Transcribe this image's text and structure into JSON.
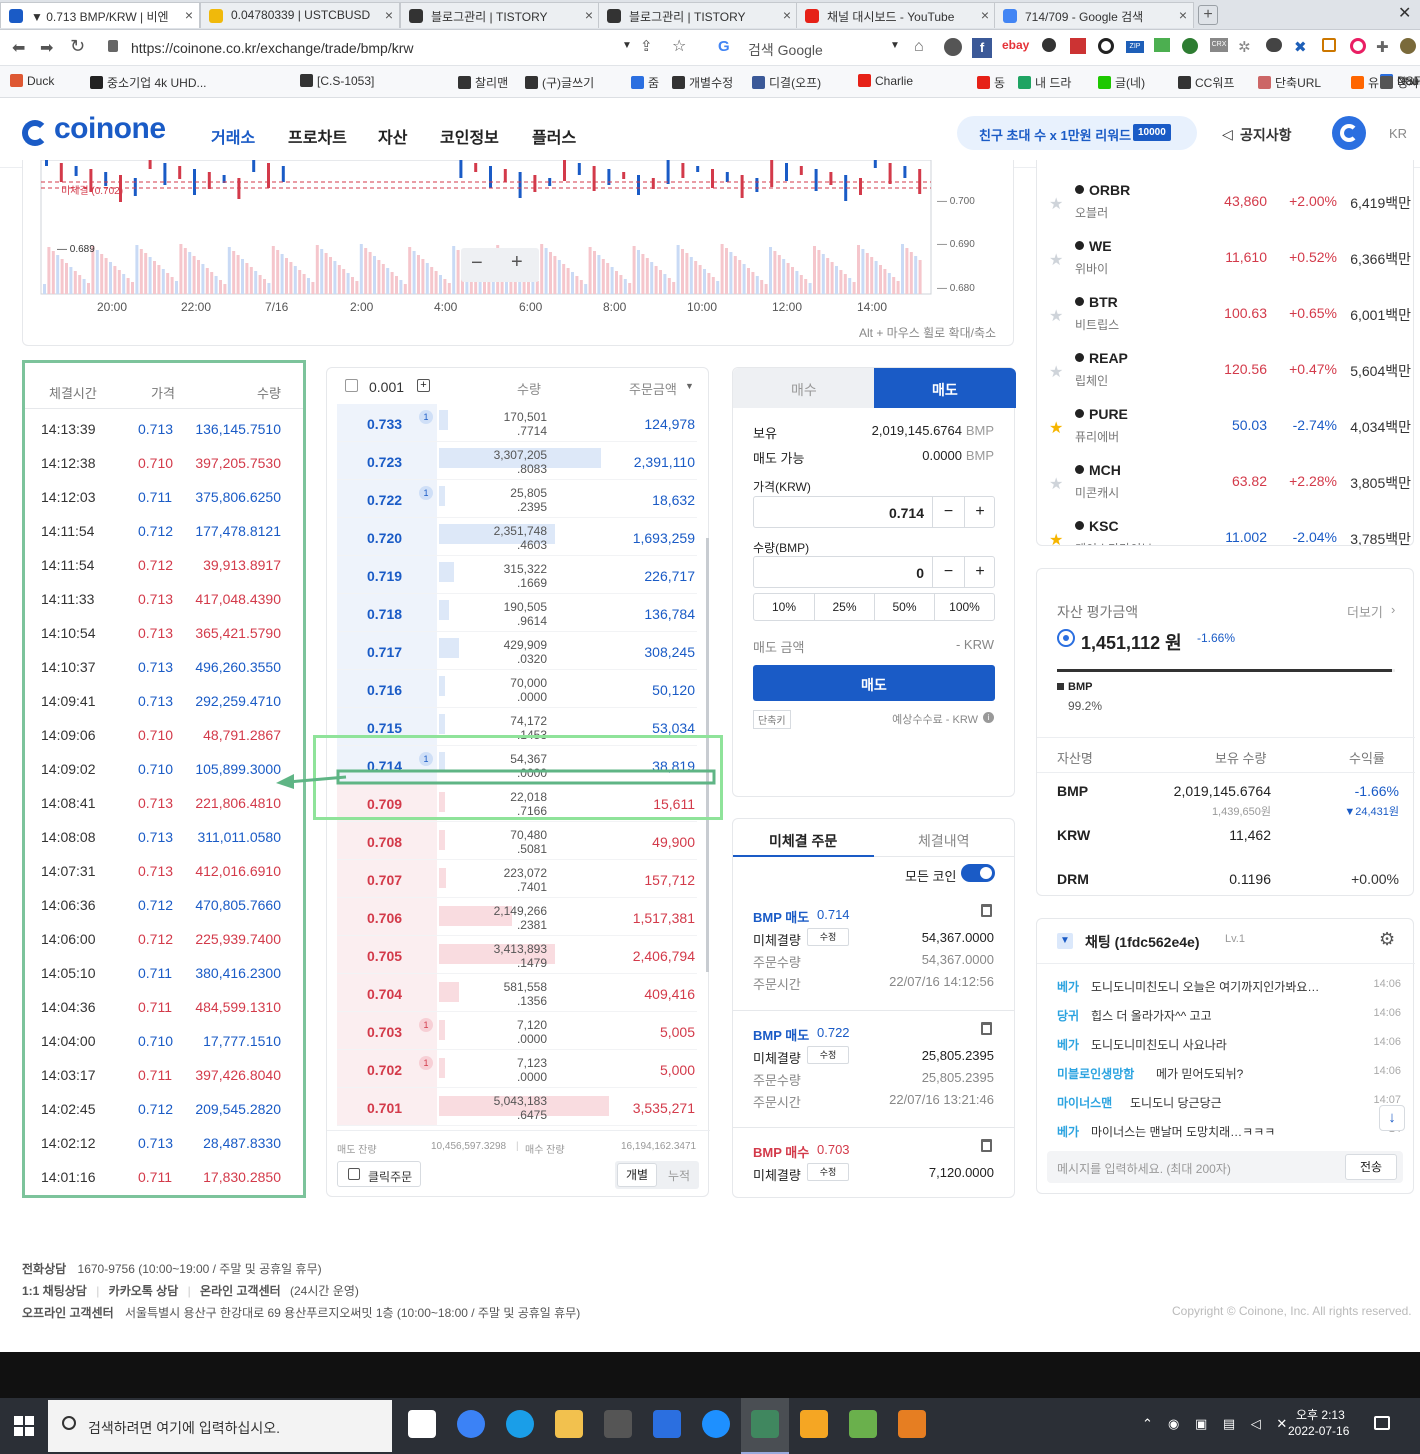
{
  "browser": {
    "tabs": [
      {
        "title": "▼ 0.713 BMP/KRW | 비엔",
        "icon": "coinone-icon",
        "color": "#1a5bc6",
        "active": true
      },
      {
        "title": "0.04780339 | USTCBUSD",
        "icon": "binance-icon",
        "color": "#f0b90b"
      },
      {
        "title": "블로그관리 | TISTORY",
        "icon": "tistory-icon",
        "color": "#333333"
      },
      {
        "title": "블로그관리 | TISTORY",
        "icon": "tistory-icon",
        "color": "#333333"
      },
      {
        "title": "채널 대시보드 - YouTube",
        "icon": "youtube-icon",
        "color": "#e62117"
      },
      {
        "title": "714/709 - Google 검색",
        "icon": "google-icon",
        "color": "#4285f4"
      }
    ],
    "url": "https://coinone.co.kr/exchange/trade/bmp/krw",
    "search_placeholder": "검색 Google",
    "bookmarks": [
      "Duck",
      "중소기업 4k UHD...",
      "[C.S-1053]",
      "찰리맨",
      "(구)글쓰기",
      "줌",
      "개별수정",
      "디결(오프)",
      "Charlie",
      "동",
      "내 드라",
      "글(네)",
      "CC워프",
      "단축URL",
      "유비",
      "NSFW",
      "Daum",
      "영사"
    ]
  },
  "site": {
    "logo": "coinone",
    "nav": [
      "거래소",
      "프로차트",
      "자산",
      "코인정보",
      "플러스"
    ],
    "promo": "친구 초대 수 x 1만원 리워드",
    "promo_badge": "10000",
    "notice": "공지사항",
    "lang": "KR"
  },
  "chart": {
    "x_ticks": [
      "20:00",
      "22:00",
      "7/16",
      "2:00",
      "4:00",
      "6:00",
      "8:00",
      "10:00",
      "12:00",
      "14:00"
    ],
    "y_ticks": [
      "0.700",
      "0.690",
      "0.680"
    ],
    "unfilled_label": "미체결 (0.702)",
    "low_label": "0.689",
    "hint": "Alt + 마우스 휠로 확대/축소",
    "zoom_out": "−",
    "zoom_in": "+"
  },
  "trades": {
    "headers": [
      "체결시간",
      "가격",
      "수량"
    ],
    "rows": [
      {
        "time": "14:13:39",
        "price": "0.713",
        "qty": "136,145.7510",
        "side": "buy"
      },
      {
        "time": "14:12:38",
        "price": "0.710",
        "qty": "397,205.7530",
        "side": "sell"
      },
      {
        "time": "14:12:03",
        "price": "0.711",
        "qty": "375,806.6250",
        "side": "buy"
      },
      {
        "time": "14:11:54",
        "price": "0.712",
        "qty": "177,478.8121",
        "side": "buy"
      },
      {
        "time": "14:11:54",
        "price": "0.712",
        "qty": "39,913.8917",
        "side": "sell"
      },
      {
        "time": "14:11:33",
        "price": "0.713",
        "qty": "417,048.4390",
        "side": "sell"
      },
      {
        "time": "14:10:54",
        "price": "0.713",
        "qty": "365,421.5790",
        "side": "sell"
      },
      {
        "time": "14:10:37",
        "price": "0.713",
        "qty": "496,260.3550",
        "side": "buy"
      },
      {
        "time": "14:09:41",
        "price": "0.713",
        "qty": "292,259.4710",
        "side": "buy"
      },
      {
        "time": "14:09:06",
        "price": "0.710",
        "qty": "48,791.2867",
        "side": "sell"
      },
      {
        "time": "14:09:02",
        "price": "0.710",
        "qty": "105,899.3000",
        "side": "buy"
      },
      {
        "time": "14:08:41",
        "price": "0.713",
        "qty": "221,806.4810",
        "side": "sell"
      },
      {
        "time": "14:08:08",
        "price": "0.713",
        "qty": "311,011.0580",
        "side": "buy"
      },
      {
        "time": "14:07:31",
        "price": "0.713",
        "qty": "412,016.6910",
        "side": "sell"
      },
      {
        "time": "14:06:36",
        "price": "0.712",
        "qty": "470,805.7660",
        "side": "buy"
      },
      {
        "time": "14:06:00",
        "price": "0.712",
        "qty": "225,939.7400",
        "side": "sell"
      },
      {
        "time": "14:05:10",
        "price": "0.711",
        "qty": "380,416.2300",
        "side": "buy"
      },
      {
        "time": "14:04:36",
        "price": "0.711",
        "qty": "484,599.1310",
        "side": "sell"
      },
      {
        "time": "14:04:00",
        "price": "0.710",
        "qty": "17,777.1510",
        "side": "buy"
      },
      {
        "time": "14:03:17",
        "price": "0.711",
        "qty": "397,426.8040",
        "side": "sell"
      },
      {
        "time": "14:02:45",
        "price": "0.712",
        "qty": "209,545.2820",
        "side": "buy"
      },
      {
        "time": "14:02:12",
        "price": "0.713",
        "qty": "28,487.8330",
        "side": "buy"
      },
      {
        "time": "14:01:16",
        "price": "0.711",
        "qty": "17,830.2850",
        "side": "sell"
      }
    ]
  },
  "orderbook": {
    "tick": "0.001",
    "headers": [
      "수량",
      "주문금액"
    ],
    "asks": [
      {
        "price": "0.733",
        "qty1": "170,501",
        "qty2": ".7714",
        "amt": "124,978",
        "badge": "1",
        "depth": 0.05
      },
      {
        "price": "0.723",
        "qty1": "3,307,205",
        "qty2": ".8083",
        "amt": "2,391,110",
        "badge": "",
        "depth": 0.95
      },
      {
        "price": "0.722",
        "qty1": "25,805",
        "qty2": ".2395",
        "amt": "18,632",
        "badge": "1",
        "depth": 0.01
      },
      {
        "price": "0.720",
        "qty1": "2,351,748",
        "qty2": ".4603",
        "amt": "1,693,259",
        "badge": "",
        "depth": 0.68
      },
      {
        "price": "0.719",
        "qty1": "315,322",
        "qty2": ".1669",
        "amt": "226,717",
        "badge": "",
        "depth": 0.09
      },
      {
        "price": "0.718",
        "qty1": "190,505",
        "qty2": ".9614",
        "amt": "136,784",
        "badge": "",
        "depth": 0.06
      },
      {
        "price": "0.717",
        "qty1": "429,909",
        "qty2": ".0320",
        "amt": "308,245",
        "badge": "",
        "depth": 0.12
      },
      {
        "price": "0.716",
        "qty1": "70,000",
        "qty2": ".0000",
        "amt": "50,120",
        "badge": "",
        "depth": 0.02
      },
      {
        "price": "0.715",
        "qty1": "74,172",
        "qty2": ".1453",
        "amt": "53,034",
        "badge": "",
        "depth": 0.02
      },
      {
        "price": "0.714",
        "qty1": "54,367",
        "qty2": ".0000",
        "amt": "38,819",
        "badge": "1",
        "depth": 0.02
      }
    ],
    "bids": [
      {
        "price": "0.709",
        "qty1": "22,018",
        "qty2": ".7166",
        "amt": "15,611",
        "badge": "",
        "depth": 0.01
      },
      {
        "price": "0.708",
        "qty1": "70,480",
        "qty2": ".5081",
        "amt": "49,900",
        "badge": "",
        "depth": 0.02
      },
      {
        "price": "0.707",
        "qty1": "223,072",
        "qty2": ".7401",
        "amt": "157,712",
        "badge": "",
        "depth": 0.04
      },
      {
        "price": "0.706",
        "qty1": "2,149,266",
        "qty2": ".2381",
        "amt": "1,517,381",
        "badge": "",
        "depth": 0.43
      },
      {
        "price": "0.705",
        "qty1": "3,413,893",
        "qty2": ".1479",
        "amt": "2,406,794",
        "badge": "",
        "depth": 0.68
      },
      {
        "price": "0.704",
        "qty1": "581,558",
        "qty2": ".1356",
        "amt": "409,416",
        "badge": "",
        "depth": 0.12
      },
      {
        "price": "0.703",
        "qty1": "7,120",
        "qty2": ".0000",
        "amt": "5,005",
        "badge": "1",
        "depth": 0.01
      },
      {
        "price": "0.702",
        "qty1": "7,123",
        "qty2": ".0000",
        "amt": "5,000",
        "badge": "1",
        "depth": 0.01
      },
      {
        "price": "0.701",
        "qty1": "5,043,183",
        "qty2": ".6475",
        "amt": "3,535,271",
        "badge": "",
        "depth": 1.0
      }
    ],
    "sell_total_label": "매도 잔량",
    "sell_total": "10,456,597.3298",
    "buy_total_label": "매수 잔량",
    "buy_total": "16,194,162.3471",
    "click_order": "클릭주문",
    "view_individual": "개별",
    "view_cumulative": "누적"
  },
  "order_form": {
    "tab_buy": "매수",
    "tab_sell": "매도",
    "holding_label": "보유",
    "holding": "2,019,145.6764",
    "unit": "BMP",
    "available_label": "매도 가능",
    "available": "0.0000",
    "price_label": "가격(KRW)",
    "price": "0.714",
    "qty_label": "수량(BMP)",
    "qty": "0",
    "pcts": [
      "10%",
      "25%",
      "50%",
      "100%"
    ],
    "amount_label": "매도 금액",
    "amount": "- KRW",
    "submit": "매도",
    "shortcut": "단축키",
    "fee": "예상수수료 - KRW"
  },
  "open_orders": {
    "tab_open": "미체결 주문",
    "tab_filled": "체결내역",
    "all_coins": "모든 코인",
    "edit": "수정",
    "labels": {
      "unfilled": "미체결량",
      "qty": "주문수량",
      "time": "주문시간"
    },
    "orders": [
      {
        "title": "BMP 매도",
        "price": "0.714",
        "unfilled": "54,367.0000",
        "qty": "54,367.0000",
        "time": "22/07/16 14:12:56",
        "side": "sell"
      },
      {
        "title": "BMP 매도",
        "price": "0.722",
        "unfilled": "25,805.2395",
        "qty": "25,805.2395",
        "time": "22/07/16 13:21:46",
        "side": "sell"
      },
      {
        "title": "BMP 매수",
        "price": "0.703",
        "unfilled": "7,120.0000",
        "qty": "",
        "time": "",
        "side": "buy"
      }
    ]
  },
  "coins": [
    {
      "sym": "ORBR",
      "name": "오블러",
      "price": "43,860",
      "chg": "+2.00%",
      "vol": "6,419백만",
      "fav": false,
      "up": true
    },
    {
      "sym": "WE",
      "name": "위바이",
      "price": "11,610",
      "chg": "+0.52%",
      "vol": "6,366백만",
      "fav": false,
      "up": true
    },
    {
      "sym": "BTR",
      "name": "비트립스",
      "price": "100.63",
      "chg": "+0.65%",
      "vol": "6,001백만",
      "fav": false,
      "up": true
    },
    {
      "sym": "REAP",
      "name": "립체인",
      "price": "120.56",
      "chg": "+0.47%",
      "vol": "5,604백만",
      "fav": false,
      "up": true
    },
    {
      "sym": "PURE",
      "name": "퓨리에버",
      "price": "50.03",
      "chg": "-2.74%",
      "vol": "4,034백만",
      "fav": true,
      "up": false
    },
    {
      "sym": "MCH",
      "name": "미콘캐시",
      "price": "63.82",
      "chg": "+2.28%",
      "vol": "3,805백만",
      "fav": false,
      "up": true
    },
    {
      "sym": "KSC",
      "name": "케이스타라이브",
      "price": "11.002",
      "chg": "-2.04%",
      "vol": "3,785백만",
      "fav": true,
      "up": false
    }
  ],
  "assets": {
    "title": "자산 평가금액",
    "more": "더보기",
    "total": "1,451,112 원",
    "total_chg": "-1.66%",
    "bar_coin": "BMP",
    "bar_pct": "99.2%",
    "bar_fraction": 0.992,
    "headers": [
      "자산명",
      "보유 수량",
      "수익률"
    ],
    "rows": [
      {
        "name": "BMP",
        "qty": "2,019,145.6764",
        "sub": "1,439,650원",
        "ret": "-1.66%",
        "ret_sub": "▼24,431원"
      },
      {
        "name": "KRW",
        "qty": "11,462",
        "sub": "",
        "ret": "",
        "ret_sub": ""
      },
      {
        "name": "DRM",
        "qty": "0.1196",
        "sub": "",
        "ret": "+0.00%",
        "ret_sub": ""
      }
    ]
  },
  "chat": {
    "title": "채팅 (1fdc562e4e)",
    "level": "Lv.1",
    "messages": [
      {
        "user": "베가",
        "text": "도니도니미친도니 오늘은 여기까지인가봐요…",
        "time": "14:06"
      },
      {
        "user": "당귀",
        "text": "힙스 더 올라가자^^ 고고",
        "time": "14:06"
      },
      {
        "user": "베가",
        "text": "도니도니미친도니 사요나라",
        "time": "14:06"
      },
      {
        "user": "미블로인생망함",
        "text": "메가 믿어도되뉘?",
        "time": "14:06"
      },
      {
        "user": "마이너스맨",
        "text": "도니도니 당근당근",
        "time": "14:07"
      },
      {
        "user": "베가",
        "text": "마이너스는 맨날머 도망치래…ㅋㅋㅋ",
        "time": "14"
      }
    ],
    "placeholder": "메시지를 입력하세요. (최대 200자)",
    "send": "전송"
  },
  "footer": {
    "line1_label": "전화상담",
    "line1": "1670-9756 (10:00~19:00 / 주말 및 공휴일 휴무)",
    "line2a": "1:1 채팅상담",
    "line2b": "카카오톡 상담",
    "line2c": "온라인 고객센터",
    "line2d": "(24시간 운영)",
    "line3_label": "오프라인 고객센터",
    "line3": "서울특별시 용산구 한강대로 69 용산푸르지오써밋 1층 (10:00~18:00 / 주말 및 공휴일 휴무)",
    "copyright": "Copyright © Coinone, Inc. All rights reserved."
  },
  "taskbar": {
    "search": "검색하려면 여기에 입력하십시오.",
    "time": "오후 2:13",
    "date": "2022-07-16"
  }
}
